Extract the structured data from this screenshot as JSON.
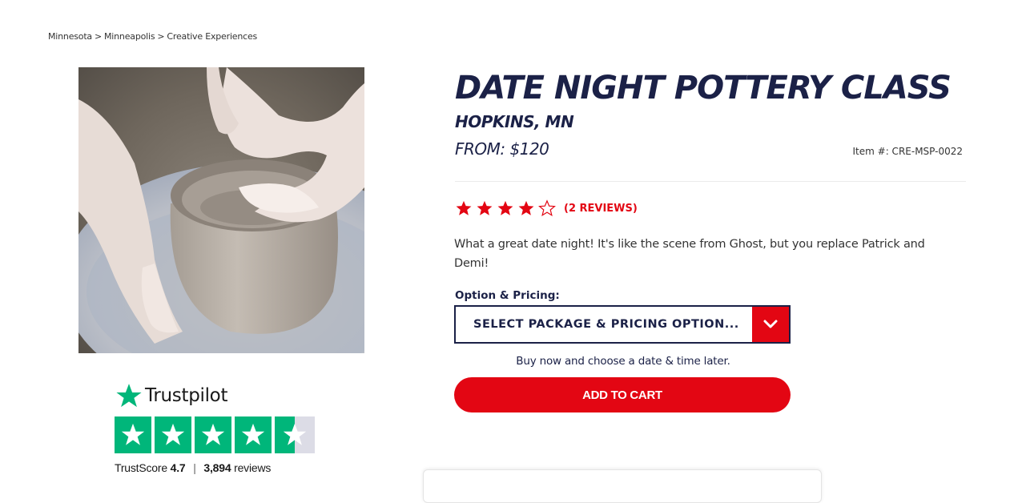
{
  "breadcrumb": {
    "items": [
      "Minnesota",
      "Minneapolis",
      "Creative Experiences"
    ],
    "separator": ">"
  },
  "product": {
    "title": "DATE NIGHT POTTERY CLASS",
    "location": "HOPKINS, MN",
    "price": "FROM: $120",
    "item_number": "Item #: CRE-MSP-0022",
    "rating": 4,
    "rating_max": 5,
    "reviews_label": "(2 REVIEWS)",
    "description": "What a great date night! It's like the scene from Ghost, but you replace Patrick and Demi!",
    "image_icon": "pottery-wheel-photo"
  },
  "options": {
    "label": "Option & Pricing:",
    "select_value": "SELECT PACKAGE & PRICING OPTION...",
    "buy_note": "Buy now and choose a date & time later.",
    "add_to_cart": "ADD TO CART"
  },
  "trustpilot": {
    "brand": "Trustpilot",
    "score_label": "TrustScore",
    "score": "4.7",
    "reviews_count": "3,894",
    "reviews_word": "reviews",
    "stars": 4.5
  },
  "colors": {
    "navy": "#1b2147",
    "red": "#e30613",
    "trustpilot_green": "#00b67a"
  }
}
